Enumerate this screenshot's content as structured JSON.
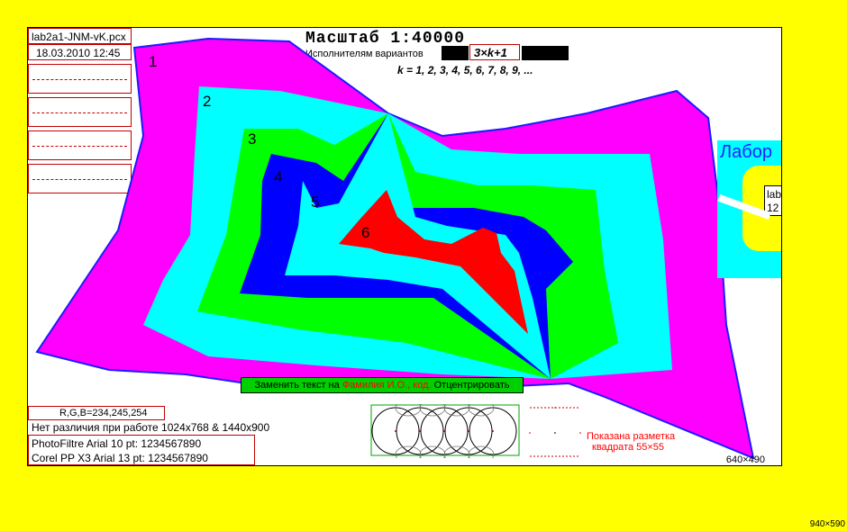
{
  "file_info": {
    "filename": "lab2a1-JNM-vK.pcx",
    "datetime": "18.03.2010 12:45"
  },
  "header": {
    "title": "Масштаб 1:40000",
    "performers_label": "Исполнителям вариантов",
    "formula": "3×k+1",
    "k_sequence": "k = 1, 2, 3, 4, 5, 6, 7, 8, 9, ..."
  },
  "map_labels": [
    "1",
    "2",
    "3",
    "4",
    "5",
    "6"
  ],
  "colors": {
    "background": "#ffff00",
    "zone1": "#ff00ff",
    "zone2": "#00ffff",
    "zone3": "#00ff00",
    "zone4": "#0000ff",
    "zone5": "#00ffff",
    "zone6": "#ff0000",
    "outline": "#1a1aff"
  },
  "instruction": {
    "prefix": "Заменить текст на ",
    "highlight": "Фамилия И.О., код.",
    "suffix": " Отцентрировать"
  },
  "bottom_info": {
    "rgb": "R,G,B=234,245,254",
    "no_difference": "Нет различия при работе 1024x768  & 1440x900",
    "photofiltre": "PhotoFiltre  Arial  10 pt:   1234567890",
    "corel": "Corel PP X3  Arial 13 pt:    1234567890"
  },
  "marking_note": {
    "line1": "Показана разметка",
    "line2": "квадрата 55×55"
  },
  "size_label": "640×490",
  "preview": {
    "title_fragment": "Лабор",
    "box_line1": "lab",
    "box_line2": "12"
  },
  "outer_size": "940×590"
}
